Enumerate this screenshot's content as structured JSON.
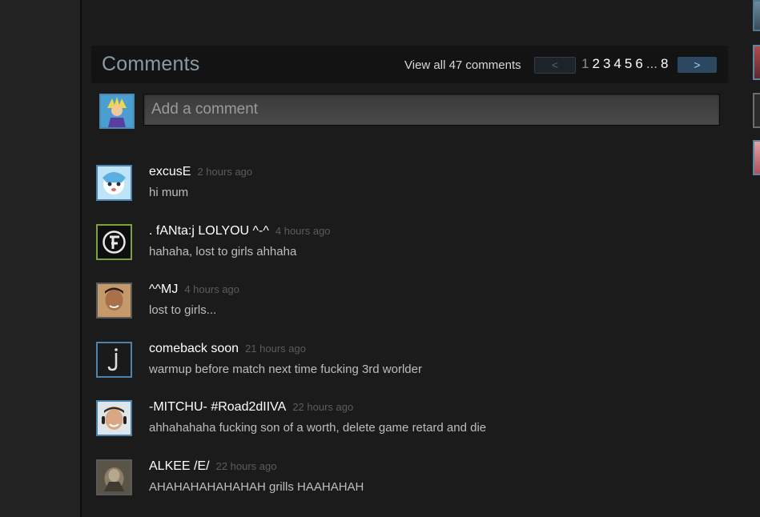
{
  "header": {
    "title": "Comments",
    "view_all": "View all 47 comments",
    "prev_label": "<",
    "next_label": ">",
    "pages": [
      "1",
      "2",
      "3",
      "4",
      "5",
      "6",
      "...",
      "8"
    ],
    "current_page": "1"
  },
  "input": {
    "placeholder": "Add a comment"
  },
  "comments": [
    {
      "author": "excusE",
      "time": "2 hours ago",
      "text": "hi mum"
    },
    {
      "author": ". fANta:j LOLYOU ^-^",
      "time": "4 hours ago",
      "text": "hahaha, lost to girls ahhaha"
    },
    {
      "author": "^^MJ",
      "time": "4 hours ago",
      "text": "lost to girls..."
    },
    {
      "author": "comeback soon",
      "time": "21 hours ago",
      "text": "warmup before match next time fucking 3rd worlder"
    },
    {
      "author": "-MITCHU- #Road2dIIVA",
      "time": "22 hours ago",
      "text": "ahhahahaha fucking son of a worth, delete game retard and die"
    },
    {
      "author": "ALKEE /E/",
      "time": "22 hours ago",
      "text": "AHAHAHAHAHAHAH grills HAAHAHAH"
    }
  ],
  "colors": {
    "accent": "#2b4860",
    "avatar_border": "#4b85ad",
    "background": "#1b1b1b"
  }
}
